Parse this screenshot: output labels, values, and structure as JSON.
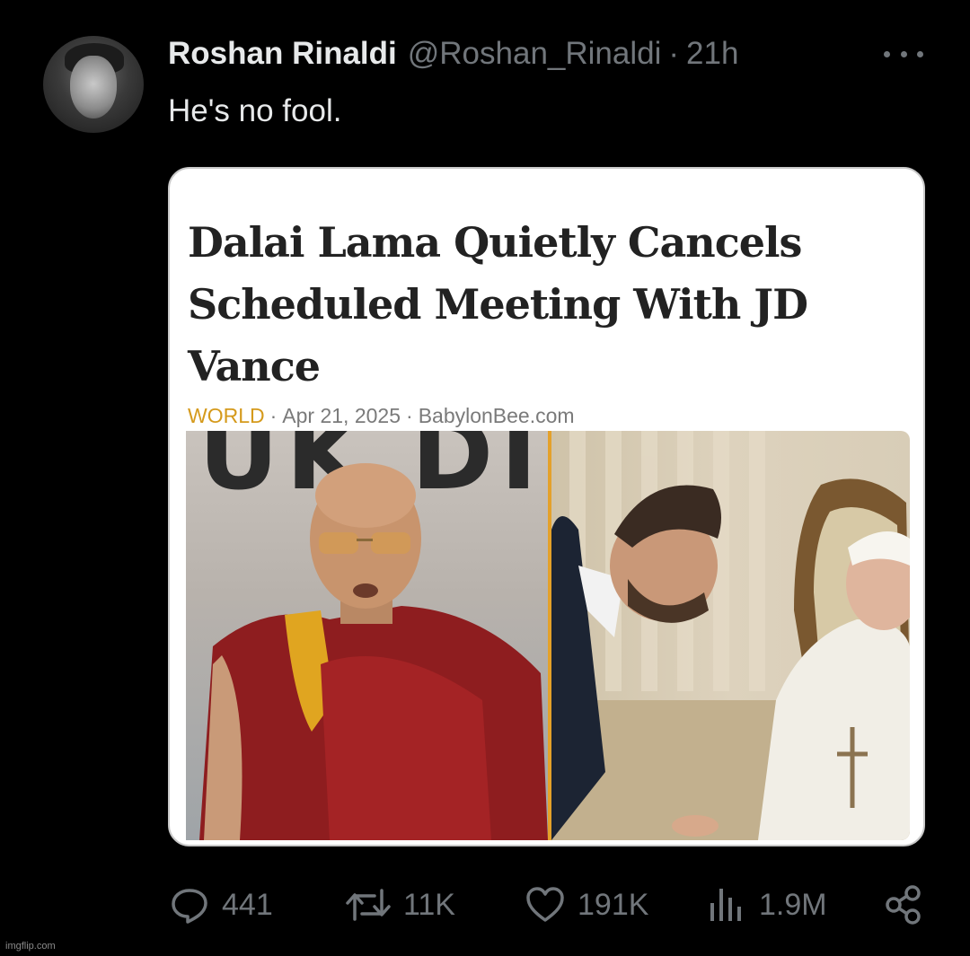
{
  "author": {
    "name": "Roshan Rinaldi",
    "handle": "@Roshan_Rinaldi",
    "separator": "·",
    "time": "21h"
  },
  "tweet": {
    "text": "He's no fool."
  },
  "article": {
    "headline": "Dalai Lama Quietly Cancels Scheduled Meeting With JD Vance",
    "section": "WORLD",
    "separator": "·",
    "date": "Apr 21, 2025",
    "source": "BabylonBee.com",
    "section_color": "#d59a1c",
    "banner_text": "UK DI"
  },
  "actions": {
    "replies": "441",
    "reposts": "11K",
    "likes": "191K",
    "views": "1.9M"
  },
  "icons": {
    "reply": "speech-bubble-icon",
    "repost": "repost-arrows-icon",
    "like": "heart-icon",
    "views": "bar-chart-icon",
    "share": "share-icon",
    "more": "ellipsis-icon"
  },
  "watermark": "imgflip.com",
  "colors": {
    "background": "#000000",
    "primary_text": "#e7e9ea",
    "secondary_text": "#71767b",
    "divider_accent": "#e4a12a"
  }
}
